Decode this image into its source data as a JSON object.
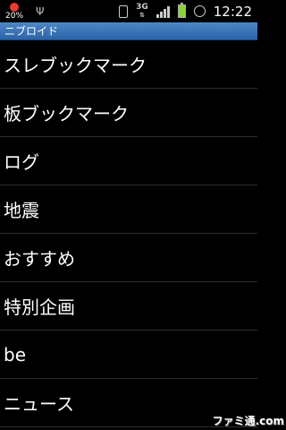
{
  "status_bar": {
    "battery_percent": "20%",
    "network_type": "3G",
    "time": "12:22",
    "icons": [
      "battery-percent-icon",
      "usb-icon",
      "vibrate-icon",
      "network-3g-icon",
      "signal-icon",
      "battery-icon",
      "alarm-icon"
    ],
    "battery_color": "#8bd23a"
  },
  "app": {
    "title": "ニブロイド",
    "title_bar_color": "#3a74b8"
  },
  "menu": {
    "items": [
      {
        "label": "スレブックマーク"
      },
      {
        "label": "板ブックマーク"
      },
      {
        "label": "ログ"
      },
      {
        "label": "地震"
      },
      {
        "label": "おすすめ"
      },
      {
        "label": "特別企画"
      },
      {
        "label": "be"
      },
      {
        "label": "ニュース"
      }
    ]
  },
  "watermark": "ファミ通.com"
}
